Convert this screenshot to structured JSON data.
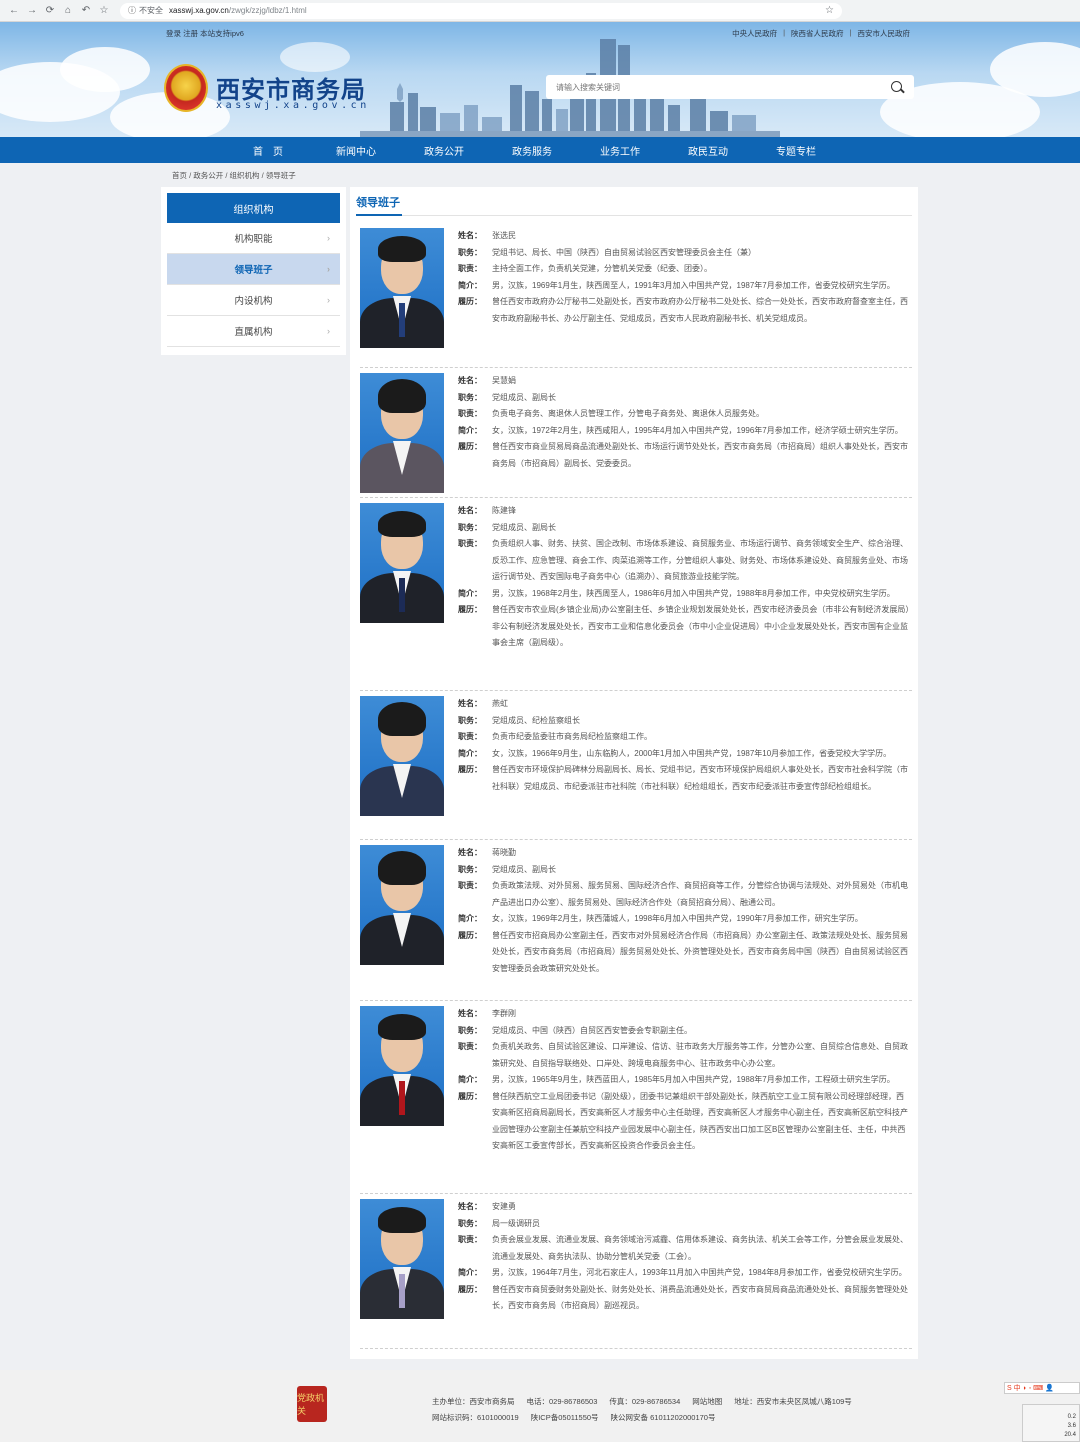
{
  "browser": {
    "insecure_label": "不安全",
    "host": "xasswj.xa.gov.cn",
    "path": "/zwgk/zzjg/ldbz/1.html"
  },
  "header": {
    "top_left": "登录 注册 本站支持ipv6",
    "top_right": [
      "中央人民政府",
      "陕西省人民政府",
      "西安市人民政府"
    ],
    "title": "西安市商务局",
    "subtitle": "xasswj.xa.gov.cn",
    "search_placeholder": "请输入搜索关键词"
  },
  "nav": [
    "首　页",
    "新闻中心",
    "政务公开",
    "政务服务",
    "业务工作",
    "政民互动",
    "专题专栏"
  ],
  "breadcrumb": "首页 / 政务公开 / 组织机构 / 领导班子",
  "sidebar": {
    "title": "组织机构",
    "items": [
      {
        "label": "机构职能",
        "active": false
      },
      {
        "label": "领导班子",
        "active": true
      },
      {
        "label": "内设机构",
        "active": false
      },
      {
        "label": "直属机构",
        "active": false
      }
    ]
  },
  "main": {
    "title": "领导班子",
    "labels": {
      "name": "姓名：",
      "post": "职务：",
      "duty": "职责：",
      "brief": "简介：",
      "resume": "履历："
    },
    "people": [
      {
        "name": "张选民",
        "post": "党组书记、局长、中国（陕西）自由贸易试验区西安管理委员会主任（兼）",
        "duty": "主持全面工作，负责机关党建，分管机关党委（纪委、团委）。",
        "brief": "男，汉族，1969年1月生，陕西周至人，1991年3月加入中国共产党，1987年7月参加工作，省委党校研究生学历。",
        "resume": "曾任西安市政府办公厅秘书二处副处长，西安市政府办公厅秘书二处处长、综合一处处长，西安市政府督查室主任，西安市政府副秘书长、办公厅副主任、党组成员，西安市人民政府副秘书长、机关党组成员。"
      },
      {
        "name": "吴慧娟",
        "post": "党组成员、副局长",
        "duty": "负责电子商务、离退休人员管理工作，分管电子商务处、离退休人员服务处。",
        "brief": "女，汉族，1972年2月生，陕西咸阳人，1995年4月加入中国共产党，1996年7月参加工作，经济学硕士研究生学历。",
        "resume": "曾任西安市商业贸易局商品流通处副处长、市场运行调节处处长，西安市商务局（市招商局）组织人事处处长，西安市商务局（市招商局）副局长、党委委员。"
      },
      {
        "name": "陈建锋",
        "post": "党组成员、副局长",
        "duty": "负责组织人事、财务、扶贫、国企改制、市场体系建设、商贸服务业、市场运行调节、商务领域安全生产、综合治理、反恐工作、应急管理、商会工作、肉菜追溯等工作，分管组织人事处、财务处、市场体系建设处、商贸服务业处、市场运行调节处、西安国际电子商务中心（追溯办）、商贸旅游业技能学院。",
        "brief": "男，汉族，1968年2月生，陕西周至人，1986年6月加入中国共产党，1988年8月参加工作，中央党校研究生学历。",
        "resume": "曾任西安市农业局(乡镇企业局)办公室副主任、乡镇企业规划发展处处长，西安市经济委员会（市非公有制经济发展局）非公有制经济发展处处长，西安市工业和信息化委员会（市中小企业促进局）中小企业发展处处长，西安市国有企业监事会主席（副局级）。"
      },
      {
        "name": "燕虹",
        "post": "党组成员、纪检监察组长",
        "duty": "负责市纪委监委驻市商务局纪检监察组工作。",
        "brief": "女，汉族，1966年9月生，山东临朐人，2000年1月加入中国共产党，1987年10月参加工作，省委党校大学学历。",
        "resume": "曾任西安市环境保护局碑林分局副局长、局长、党组书记，西安市环境保护局组织人事处处长，西安市社会科学院（市社科联）党组成员、市纪委派驻市社科院（市社科联）纪检组组长，西安市纪委派驻市委宣传部纪检组组长。"
      },
      {
        "name": "蒋晓勤",
        "post": "党组成员、副局长",
        "duty": "负责政策法规、对外贸易、服务贸易、国际经济合作、商贸招商等工作，分管综合协调与法规处、对外贸易处（市机电产品进出口办公室）、服务贸易处、国际经济合作处（商贸招商分局）、融通公司。",
        "brief": "女，汉族，1969年2月生，陕西蒲城人，1998年6月加入中国共产党，1990年7月参加工作，研究生学历。",
        "resume": "曾任西安市招商局办公室副主任，西安市对外贸易经济合作局（市招商局）办公室副主任、政策法规处处长、服务贸易处处长，西安市商务局（市招商局）服务贸易处处长、外资管理处处长，西安市商务局中国（陕西）自由贸易试验区西安管理委员会政策研究处处长。"
      },
      {
        "name": "李群刚",
        "post": "党组成员、中国（陕西）自贸区西安管委会专职副主任。",
        "duty": "负责机关政务、自贸试验区建设、口岸建设、信访、驻市政务大厅服务等工作，分管办公室、自贸综合信息处、自贸政策研究处、自贸指导联络处、口岸处、跨境电商服务中心、驻市政务中心办公室。",
        "brief": "男，汉族，1965年9月生，陕西蓝田人，1985年5月加入中国共产党，1988年7月参加工作，工程硕士研究生学历。",
        "resume": "曾任陕西航空工业局团委书记（副处级），团委书记兼组织干部处副处长，陕西航空工业工贸有限公司经理部经理，西安高新区招商局副局长，西安高新区人才服务中心主任助理，西安高新区人才服务中心副主任，西安高新区航空科技产业园管理办公室副主任兼航空科技产业园发展中心副主任，陕西西安出口加工区B区管理办公室副主任、主任，中共西安高新区工委宣传部长，西安高新区投资合作委员会主任。"
      },
      {
        "name": "安建勇",
        "post": "局一级调研员",
        "duty": "负责会展业发展、流通业发展、商务领域治污减霾、信用体系建设、商务执法、机关工会等工作，分管会展业发展处、流通业发展处、商务执法队、协助分管机关党委（工会）。",
        "brief": "男，汉族，1964年7月生，河北石家庄人，1993年11月加入中国共产党，1984年8月参加工作，省委党校研究生学历。",
        "resume": "曾任西安市商贸委财务处副处长、财务处处长、消费品流通处处长，西安市商贸局商品流通处处长、商贸服务管理处处长，西安市商务局（市招商局）副巡视员。"
      }
    ]
  },
  "footer": {
    "logo_text": "党政机关",
    "line1": [
      "主办单位：西安市商务局",
      "电话：029-86786503",
      "传真：029-86786534",
      "网站地图",
      "地址：西安市未央区凤城八路109号"
    ],
    "line2": [
      "网站标识码：6101000019",
      "陕ICP备05011550号",
      "陕公网安备 61011202000170号"
    ]
  },
  "tray": {
    "ime": "S 中 ◗ ◦ ⌨ 👤",
    "lines": [
      "0.2",
      "3.6",
      "20.4"
    ]
  }
}
